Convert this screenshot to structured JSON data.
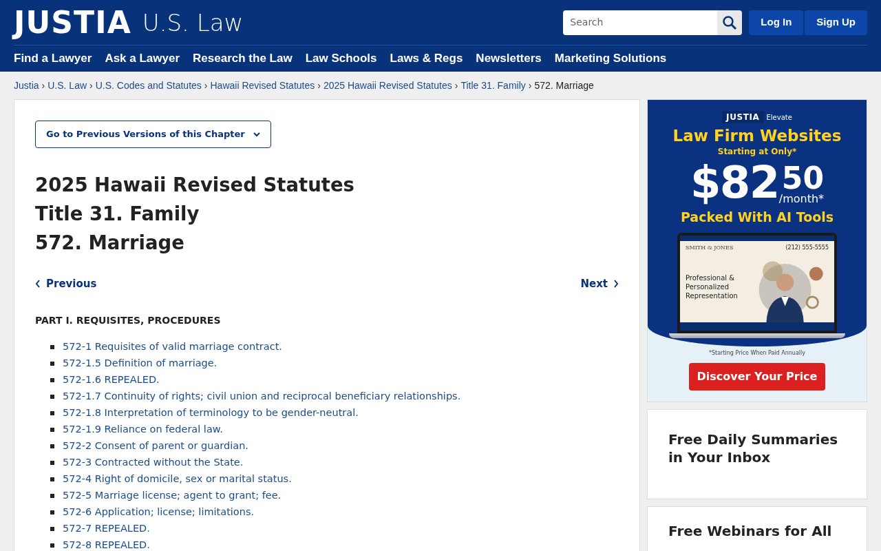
{
  "header": {
    "logo": "JUSTIA",
    "logo_sub": "U.S. Law",
    "search": {
      "placeholder": "Search"
    },
    "buttons": [
      "Log In",
      "Sign Up"
    ],
    "nav": [
      "Find a Lawyer",
      "Ask a Lawyer",
      "Research the Law",
      "Law Schools",
      "Laws & Regs",
      "Newsletters",
      "Marketing Solutions"
    ]
  },
  "breadcrumbs": [
    {
      "label": "Justia",
      "link": true
    },
    {
      "separator": "›",
      "label": "U.S. Law",
      "link": true
    },
    {
      "separator": "›",
      "label": "U.S. Codes and Statutes",
      "link": true
    },
    {
      "separator": "›",
      "label": "Hawaii Revised Statutes",
      "link": true
    },
    {
      "separator": "›",
      "label": "2025 Hawaii Revised Statutes",
      "link": true
    },
    {
      "separator": "›",
      "label": "Title 31. Family",
      "link": true
    },
    {
      "separator": "›",
      "label": "572. Marriage",
      "link": false
    }
  ],
  "versions_button": "Go to Previous Versions of this Chapter",
  "title_lines": [
    "2025 Hawaii Revised Statutes",
    "Title 31. Family",
    "572. Marriage"
  ],
  "pager": {
    "previous": "Previous",
    "next": "Next"
  },
  "part_heading": "PART I. REQUISITES, PROCEDURES",
  "sections": [
    "572-1 Requisites of valid marriage contract.",
    "572-1.5 Definition of marriage.",
    "572-1.6 REPEALED.",
    "572-1.7 Continuity of rights; civil union and reciprocal beneficiary relationships.",
    "572-1.8 Interpretation of terminology to be gender-neutral.",
    "572-1.9 Reliance on federal law.",
    "572-2 Consent of parent or guardian.",
    "572-3 Contracted without the State.",
    "572-4 Right of domicile, sex or marital status.",
    "572-5 Marriage license; agent to grant; fee.",
    "572-6 Application; license; limitations.",
    "572-7 REPEALED.",
    "572-8 REPEALED."
  ],
  "ad": {
    "brand": "JUSTIA",
    "brand_sub": "Elevate",
    "headline": "Law Firm Websites",
    "subhead": "Starting at Only*",
    "price_main": "$82",
    "price_cents": "50",
    "price_unit": "/month*",
    "tagline": "Packed With AI Tools",
    "laptop": {
      "firm": "SMITH & JONES",
      "phone": "(212) 555-5555",
      "hero": "Professional & Personalized Representation"
    },
    "footnote": "*Starting Price When Paid Annually",
    "cta": "Discover Your Price"
  },
  "cards": [
    "Free Daily Summaries in Your Inbox",
    "Free Webinars for All"
  ]
}
